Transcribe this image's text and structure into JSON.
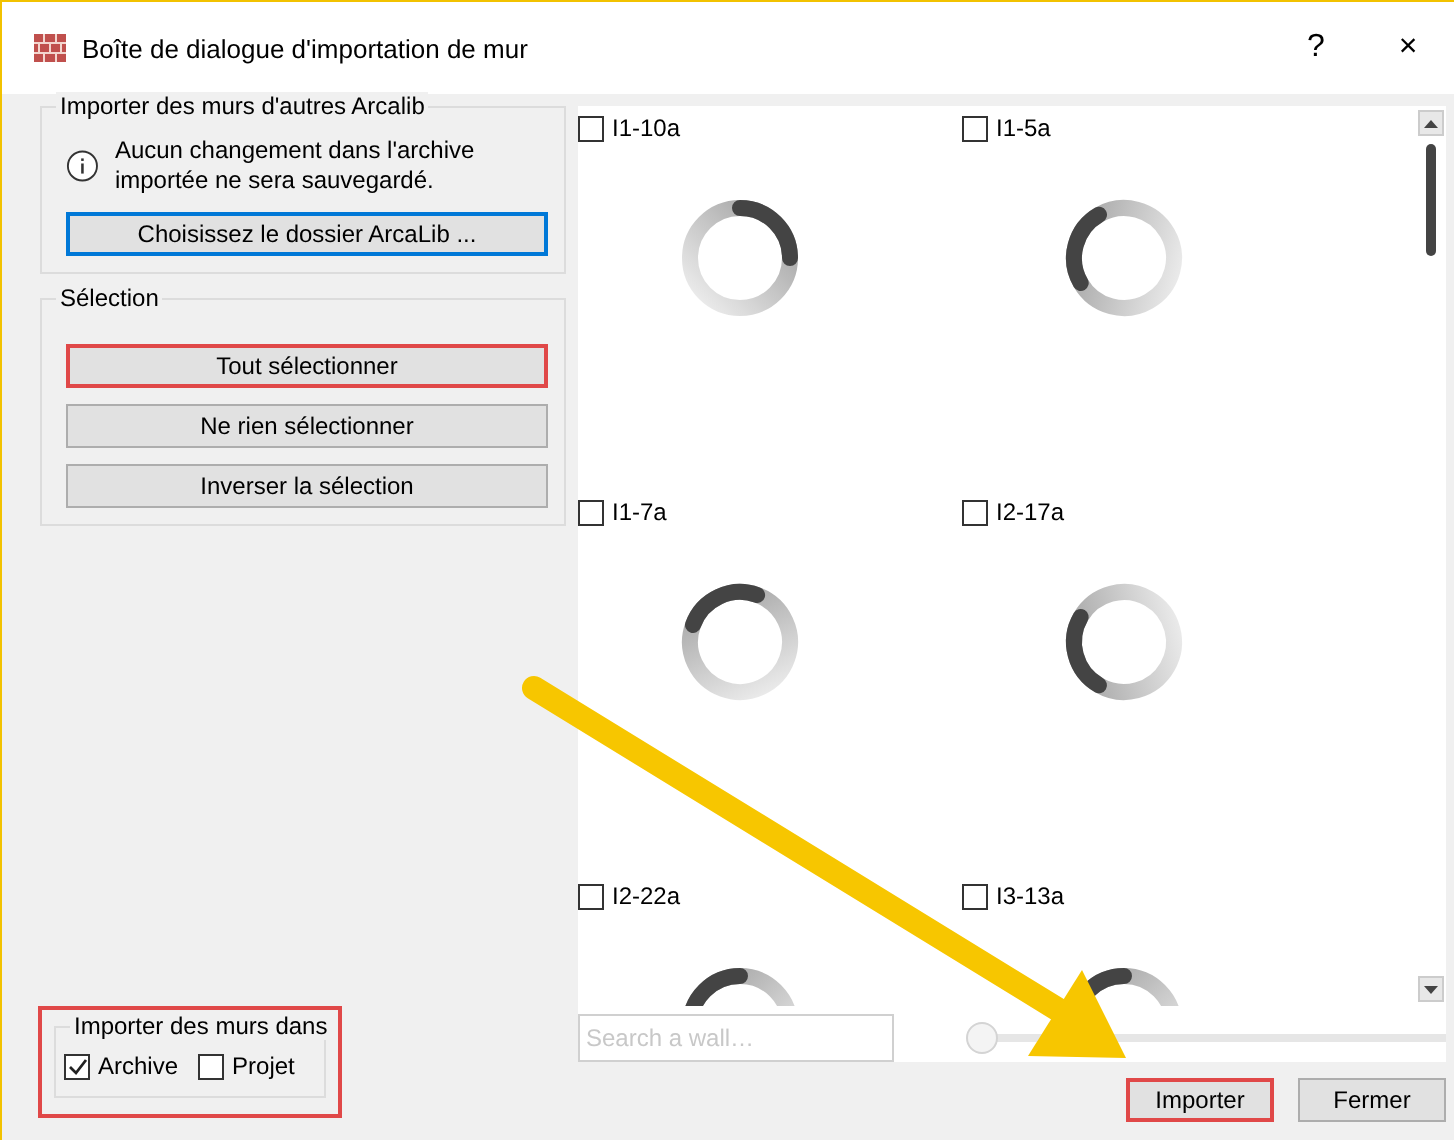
{
  "window": {
    "title": "Boîte de dialogue d'importation de mur",
    "help": "?",
    "close": "×"
  },
  "source_group": {
    "title": "Importer des murs d'autres Arcalib",
    "message": "Aucun changement dans l'archive importée ne sera sauvegardé.",
    "button": {
      "label": "Choisissez le dossier ArcaLib ...",
      "focused": true
    }
  },
  "selection_group": {
    "title": "Sélection",
    "buttons": [
      {
        "label": "Tout sélectionner",
        "highlighted": true
      },
      {
        "label": "Ne rien sélectionner",
        "highlighted": false
      },
      {
        "label": "Inverser la sélection",
        "highlighted": false
      }
    ]
  },
  "target_group": {
    "title": "Importer des murs dans",
    "highlighted": true,
    "options": [
      {
        "label": "Archive",
        "checked": true
      },
      {
        "label": "Projet",
        "checked": false
      }
    ]
  },
  "walls": [
    {
      "label": "I1-10a",
      "checked": false
    },
    {
      "label": "I1-5a",
      "checked": false
    },
    {
      "label": "I1-7a",
      "checked": false
    },
    {
      "label": "I2-17a",
      "checked": false
    },
    {
      "label": "I2-22a",
      "checked": false
    },
    {
      "label": "I3-13a",
      "checked": false
    }
  ],
  "search": {
    "placeholder": "Search a wall…"
  },
  "size_slider": {
    "level": 0
  },
  "buttons": [
    {
      "label": "Importer",
      "highlighted": true
    },
    {
      "label": "Fermer",
      "highlighted": false
    }
  ]
}
